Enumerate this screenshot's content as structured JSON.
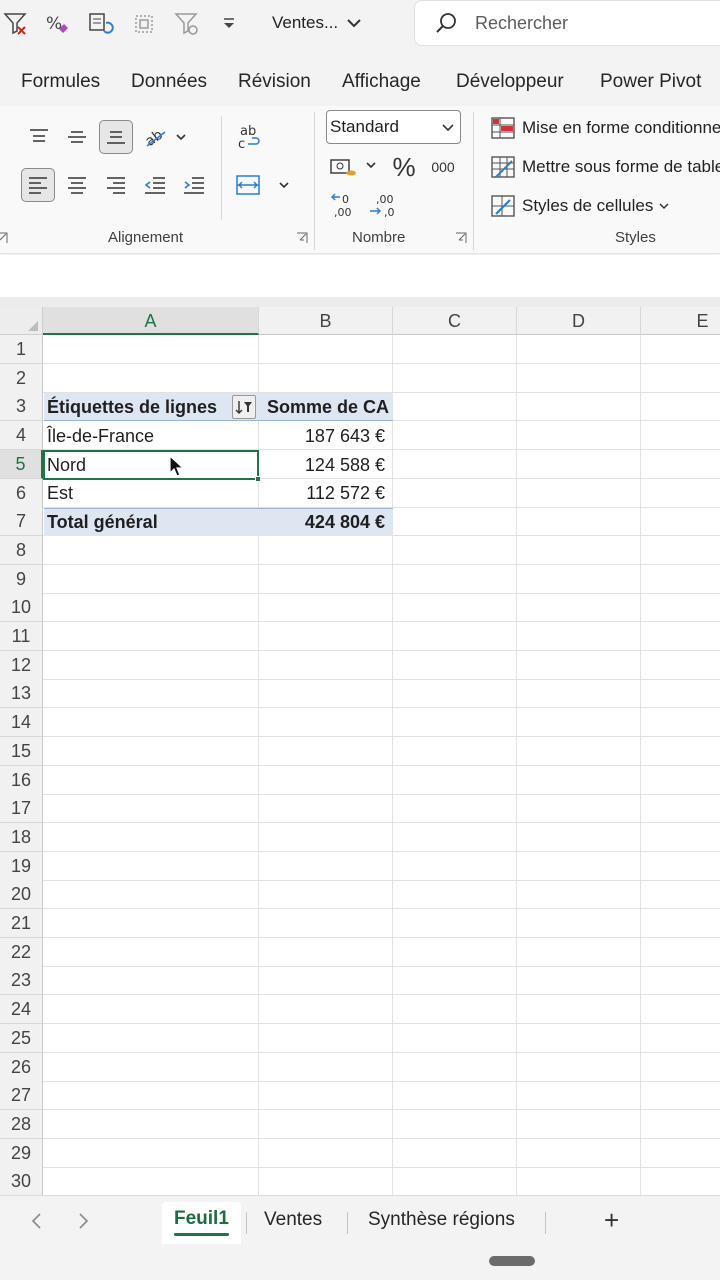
{
  "titlebar": {
    "doc_title": "Ventes...",
    "search_placeholder": "Rechercher"
  },
  "tabs": [
    "Formules",
    "Données",
    "Révision",
    "Affichage",
    "Développeur",
    "Power Pivot"
  ],
  "ribbon": {
    "alignment_label": "Alignement",
    "number_label": "Nombre",
    "styles_label": "Styles",
    "number_format": "Standard",
    "percent_symbol": "%",
    "thousands_symbol": "000",
    "conditional_formatting": "Mise en forme conditionnelle",
    "format_as_table": "Mettre sous forme de tableau",
    "cell_styles": "Styles de cellules"
  },
  "grid": {
    "columns": [
      "A",
      "B",
      "C",
      "D",
      "E"
    ],
    "rows": [
      "1",
      "2",
      "3",
      "4",
      "5",
      "6",
      "7",
      "8",
      "9",
      "10",
      "11",
      "12",
      "13",
      "14",
      "15",
      "16",
      "17",
      "18",
      "19",
      "20",
      "21",
      "22",
      "23",
      "24",
      "25",
      "26",
      "27",
      "28",
      "29",
      "30"
    ],
    "pivot": {
      "header_labels": "Étiquettes de lignes",
      "header_values": "Somme de CA",
      "rows": [
        {
          "label": "Île-de-France",
          "value": "187 643 €"
        },
        {
          "label": "Nord",
          "value": "124 588 €"
        },
        {
          "label": "Est",
          "value": "112 572 €"
        }
      ],
      "total_label": "Total général",
      "total_value": "424 804 €"
    }
  },
  "sheets": {
    "tabs": [
      "Feuil1",
      "Ventes",
      "Synthèse régions"
    ],
    "active": "Feuil1",
    "add_symbol": "+"
  },
  "colors": {
    "accent_green": "#217346",
    "pivot_band": "#dde6f1"
  }
}
